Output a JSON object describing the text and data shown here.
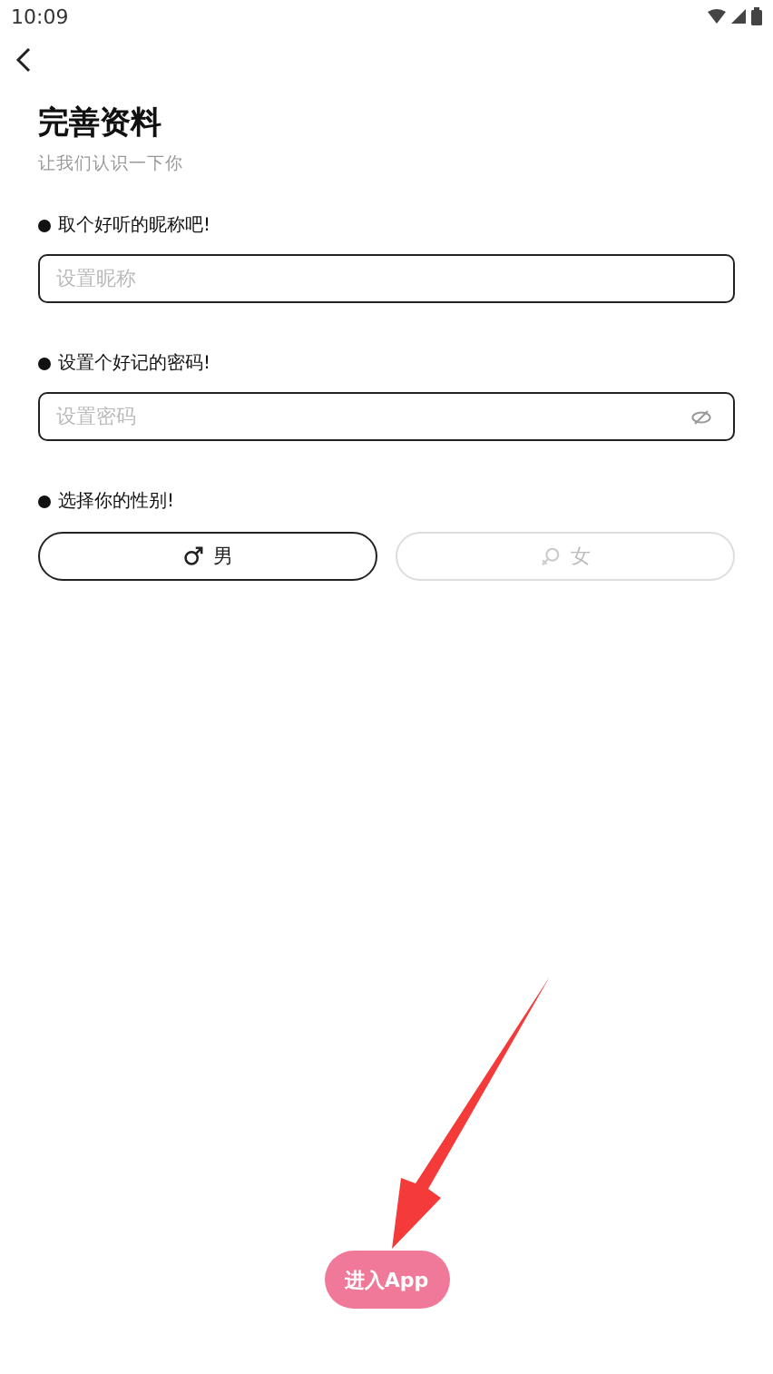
{
  "status_bar": {
    "time": "10:09"
  },
  "header": {
    "title": "完善资料",
    "subtitle": "让我们认识一下你"
  },
  "nickname": {
    "label": "取个好听的昵称吧!",
    "placeholder": "设置昵称"
  },
  "password": {
    "label": "设置个好记的密码!",
    "placeholder": "设置密码"
  },
  "gender": {
    "label": "选择你的性别!",
    "options": [
      {
        "kind": "male",
        "label": "男",
        "selected": true
      },
      {
        "kind": "female",
        "label": "女",
        "selected": false
      }
    ]
  },
  "submit": {
    "label": "进入App"
  }
}
